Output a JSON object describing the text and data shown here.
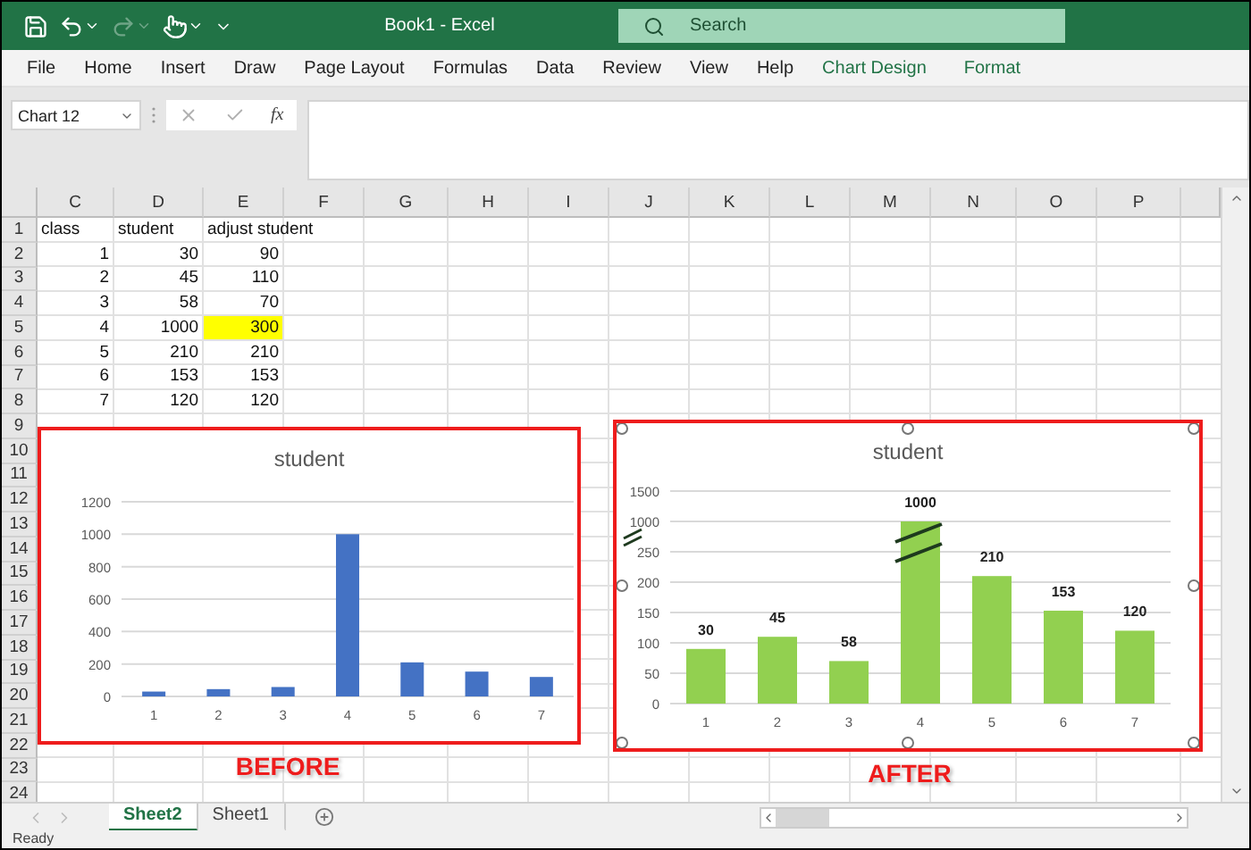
{
  "window": {
    "title": "Book1  -  Excel"
  },
  "quick_access": {
    "redo": {
      "disabled": true
    }
  },
  "search": {
    "placeholder": "Search"
  },
  "ribbon_tabs": [
    {
      "label": "File",
      "kind": "standard"
    },
    {
      "label": "Home",
      "kind": "standard"
    },
    {
      "label": "Insert",
      "kind": "standard"
    },
    {
      "label": "Draw",
      "kind": "standard"
    },
    {
      "label": "Page Layout",
      "kind": "standard"
    },
    {
      "label": "Formulas",
      "kind": "standard"
    },
    {
      "label": "Data",
      "kind": "standard"
    },
    {
      "label": "Review",
      "kind": "standard"
    },
    {
      "label": "View",
      "kind": "standard"
    },
    {
      "label": "Help",
      "kind": "standard"
    },
    {
      "label": "Chart Design",
      "kind": "contextual"
    },
    {
      "label": "Format",
      "kind": "contextual"
    }
  ],
  "formula_bar": {
    "name_box": "Chart 12",
    "function_label": "fx"
  },
  "columns": [
    "C",
    "D",
    "E",
    "F",
    "G",
    "H",
    "I",
    "J",
    "K",
    "L",
    "M",
    "N",
    "O",
    "P"
  ],
  "rows": [
    {
      "number": "1",
      "kind": "label",
      "cells": [
        {
          "text": "class",
          "highlighted": false
        },
        {
          "text": "student",
          "highlighted": false
        },
        {
          "text": "adjust student",
          "highlighted": false
        }
      ]
    },
    {
      "number": "2",
      "kind": "number",
      "cells": [
        {
          "text": "1",
          "highlighted": false
        },
        {
          "text": "30",
          "highlighted": false
        },
        {
          "text": "90",
          "highlighted": false
        }
      ]
    },
    {
      "number": "3",
      "kind": "number",
      "cells": [
        {
          "text": "2",
          "highlighted": false
        },
        {
          "text": "45",
          "highlighted": false
        },
        {
          "text": "110",
          "highlighted": false
        }
      ]
    },
    {
      "number": "4",
      "kind": "number",
      "cells": [
        {
          "text": "3",
          "highlighted": false
        },
        {
          "text": "58",
          "highlighted": false
        },
        {
          "text": "70",
          "highlighted": false
        }
      ]
    },
    {
      "number": "5",
      "kind": "number",
      "cells": [
        {
          "text": "4",
          "highlighted": false
        },
        {
          "text": "1000",
          "highlighted": false
        },
        {
          "text": "300",
          "highlighted": true
        }
      ]
    },
    {
      "number": "6",
      "kind": "number",
      "cells": [
        {
          "text": "5",
          "highlighted": false
        },
        {
          "text": "210",
          "highlighted": false
        },
        {
          "text": "210",
          "highlighted": false
        }
      ]
    },
    {
      "number": "7",
      "kind": "number",
      "cells": [
        {
          "text": "6",
          "highlighted": false
        },
        {
          "text": "153",
          "highlighted": false
        },
        {
          "text": "153",
          "highlighted": false
        }
      ]
    },
    {
      "number": "8",
      "kind": "number",
      "cells": [
        {
          "text": "7",
          "highlighted": false
        },
        {
          "text": "120",
          "highlighted": false
        },
        {
          "text": "120",
          "highlighted": false
        }
      ]
    },
    {
      "number": "9",
      "kind": "empty"
    },
    {
      "number": "10",
      "kind": "empty"
    },
    {
      "number": "11",
      "kind": "empty"
    },
    {
      "number": "12",
      "kind": "empty"
    },
    {
      "number": "13",
      "kind": "empty"
    },
    {
      "number": "14",
      "kind": "empty"
    },
    {
      "number": "15",
      "kind": "empty"
    },
    {
      "number": "16",
      "kind": "empty"
    },
    {
      "number": "17",
      "kind": "empty"
    },
    {
      "number": "18",
      "kind": "empty"
    },
    {
      "number": "19",
      "kind": "empty"
    },
    {
      "number": "20",
      "kind": "empty"
    },
    {
      "number": "21",
      "kind": "empty"
    },
    {
      "number": "22",
      "kind": "empty"
    },
    {
      "number": "23",
      "kind": "empty"
    },
    {
      "number": "24",
      "kind": "empty"
    }
  ],
  "charts": [
    {
      "caption": "BEFORE",
      "selected": false,
      "chart_data": {
        "type": "bar",
        "title": "student",
        "categories": [
          "1",
          "2",
          "3",
          "4",
          "5",
          "6",
          "7"
        ],
        "series": [
          {
            "color": "#4472c4",
            "values": [
              30,
              45,
              58,
              1000,
              210,
              153,
              120
            ]
          }
        ],
        "ylim": [
          0,
          1200
        ],
        "yticks": [
          0,
          200,
          400,
          600,
          800,
          1000,
          1200
        ],
        "grid": true
      }
    },
    {
      "caption": "AFTER",
      "selected": true,
      "axis_break": {
        "labels": [
          "1500",
          "1000"
        ]
      },
      "chart_data": {
        "type": "bar",
        "title": "student",
        "categories": [
          "1",
          "2",
          "3",
          "4",
          "5",
          "6",
          "7"
        ],
        "series": [
          {
            "color": "#92d050",
            "values": [
              90,
              110,
              70,
              300,
              210,
              153,
              120
            ]
          }
        ],
        "ylim": [
          0,
          350
        ],
        "yticks": [
          0,
          50,
          100,
          150,
          200,
          250
        ],
        "grid": true,
        "value_labels": [
          "30",
          "45",
          "58",
          "1000",
          "210",
          "153",
          "120"
        ]
      }
    }
  ],
  "sheet_tabs": [
    {
      "label": "Sheet2",
      "selected": true
    },
    {
      "label": "Sheet1",
      "selected": false
    }
  ],
  "status_bar": {
    "text": "Ready"
  }
}
